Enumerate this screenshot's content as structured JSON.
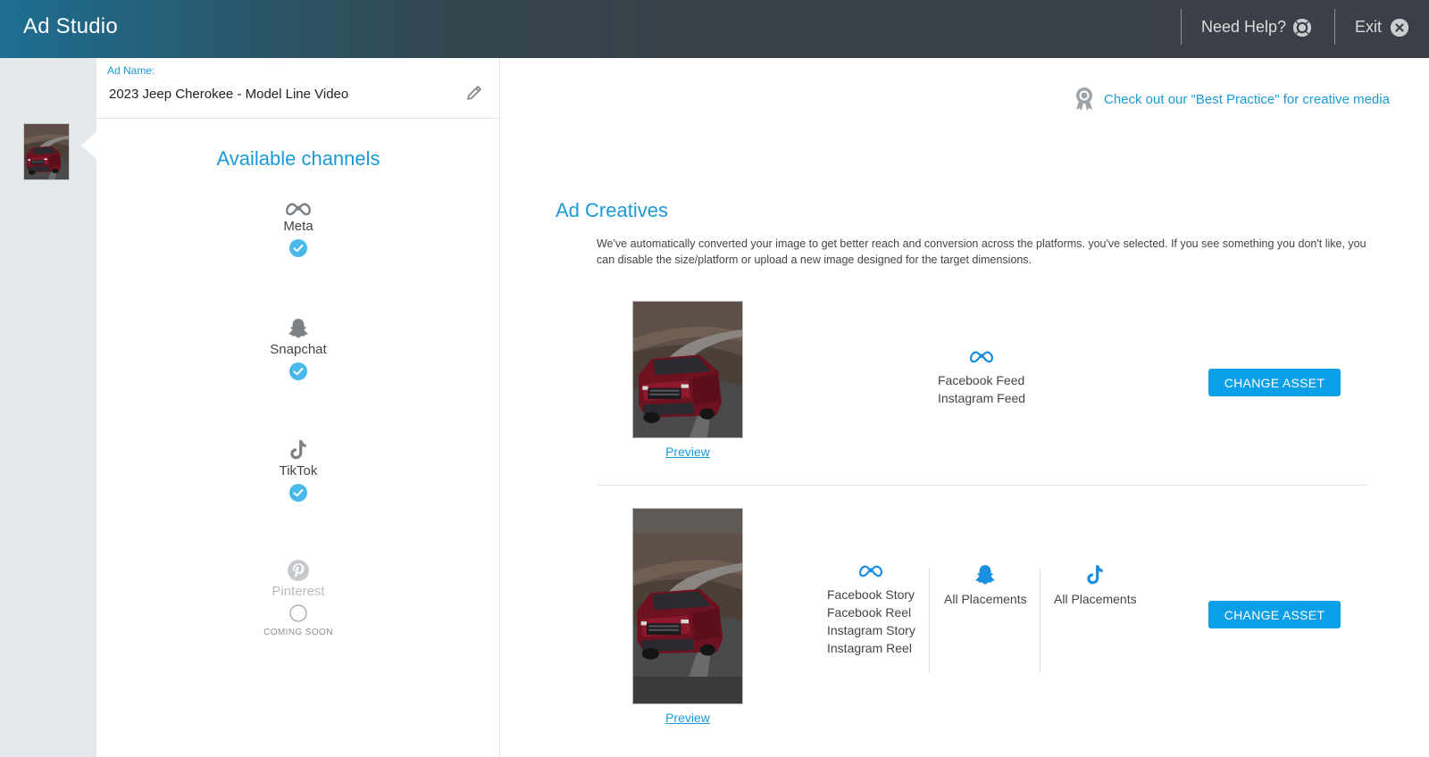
{
  "header": {
    "title": "Ad Studio",
    "help_label": "Need Help?",
    "exit_label": "Exit"
  },
  "ad": {
    "name_label": "Ad Name:",
    "name_value": "2023 Jeep Cherokee - Model Line Video"
  },
  "channels": {
    "title": "Available channels",
    "items": [
      {
        "label": "Meta",
        "icon": "meta-icon",
        "selected": true
      },
      {
        "label": "Snapchat",
        "icon": "snapchat-icon",
        "selected": true
      },
      {
        "label": "TikTok",
        "icon": "tiktok-icon",
        "selected": true
      },
      {
        "label": "Pinterest",
        "icon": "pinterest-icon",
        "selected": false,
        "note": "COMING SOON"
      }
    ]
  },
  "best_practice": {
    "label": "Check out our \"Best Practice\" for creative media"
  },
  "creatives": {
    "title": "Ad Creatives",
    "description": "We've automatically converted your image to get better reach and conversion across the platforms. you've selected. If you see something you don't like, you can disable the size/platform or upload a new image designed for the target dimensions.",
    "rows": [
      {
        "preview_label": "Preview",
        "button_label": "CHANGE ASSET",
        "groups": [
          {
            "icon": "meta-icon",
            "placements": [
              "Facebook Feed",
              "Instagram Feed"
            ]
          }
        ]
      },
      {
        "preview_label": "Preview",
        "button_label": "CHANGE ASSET",
        "groups": [
          {
            "icon": "meta-icon",
            "placements": [
              "Facebook Story",
              "Facebook Reel",
              "Instagram Story",
              "Instagram Reel"
            ]
          },
          {
            "icon": "snapchat-icon",
            "placements": [
              "All Placements"
            ]
          },
          {
            "icon": "tiktok-icon",
            "placements": [
              "All Placements"
            ]
          }
        ]
      }
    ]
  },
  "colors": {
    "accent": "#1a9ad6",
    "button": "#0b9fe8",
    "check": "#4bb8ec",
    "car_red": "#7a1424"
  }
}
